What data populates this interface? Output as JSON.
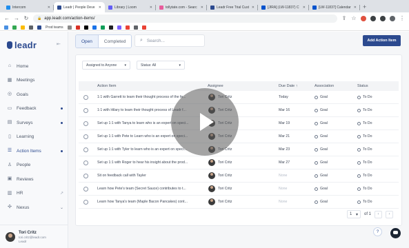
{
  "browser": {
    "tabs": [
      {
        "title": "Intercom",
        "color": "#1f8ded",
        "active": false
      },
      {
        "title": "Leadr | People Deve",
        "color": "#2c4a8f",
        "active": true
      },
      {
        "title": "Library | Loom",
        "color": "#625df5",
        "active": false
      },
      {
        "title": "tollytate.com - Searc",
        "color": "#e85d9c",
        "active": false
      },
      {
        "title": "Leadr Free Trial Cust",
        "color": "#2c4a8f",
        "active": false
      },
      {
        "title": "[JIRA] (LW-11837) C",
        "color": "#0052cc",
        "active": false
      },
      {
        "title": "[LW-11837] Calendar",
        "color": "#0052cc",
        "active": false
      }
    ],
    "new_tab": "+",
    "url": "app.leadr.com/action-items/",
    "bookmarks": {
      "label": "Prod teams"
    }
  },
  "sidebar": {
    "brand": "leadr",
    "nav": [
      {
        "label": "Home",
        "icon": "home-icon",
        "glyph": "⌂"
      },
      {
        "label": "Meetings",
        "icon": "calendar-icon",
        "glyph": "▦"
      },
      {
        "label": "Goals",
        "icon": "target-icon",
        "glyph": "◎"
      },
      {
        "label": "Feedback",
        "icon": "chat-icon",
        "glyph": "▭",
        "dot": true
      },
      {
        "label": "Surveys",
        "icon": "survey-icon",
        "glyph": "▤",
        "dot": true
      },
      {
        "label": "Learning",
        "icon": "book-icon",
        "glyph": "▯"
      },
      {
        "label": "Action Items",
        "icon": "checklist-icon",
        "glyph": "☰",
        "dot": true,
        "active": true
      },
      {
        "label": "People",
        "icon": "people-icon",
        "glyph": "♙"
      },
      {
        "label": "Reviews",
        "icon": "reviews-icon",
        "glyph": "▣"
      },
      {
        "label": "HR",
        "icon": "hr-icon",
        "glyph": "▥",
        "external": true
      },
      {
        "label": "Nexus",
        "icon": "nexus-icon",
        "glyph": "✣",
        "chevron": true
      }
    ],
    "user": {
      "name": "Tori Critz",
      "email": "tori.critz@leadr.com",
      "org": "Leadr"
    }
  },
  "main": {
    "tabs": [
      {
        "label": "Open",
        "active": true
      },
      {
        "label": "Completed",
        "active": false
      }
    ],
    "search_placeholder": "Search...",
    "add_button": "Add Action Item",
    "filters": {
      "assigned": "Assigned to Anyone",
      "status": "Status: All"
    },
    "columns": {
      "item": "Action Item",
      "assignee": "Assignee",
      "due": "Due Date",
      "association": "Association",
      "status": "Status"
    },
    "rows": [
      {
        "item": "1:1 with Garrett to learn their thought process of the fe...",
        "assignee": "Tori Critz",
        "due": "Today",
        "association": "Goal",
        "status": "To Do"
      },
      {
        "item": "1:1 with Hilary to learn their thought process of Leadr f...",
        "assignee": "Tori Critz",
        "due": "Mar 16",
        "association": "Goal",
        "status": "To Do"
      },
      {
        "item": "Set up 1:1 with Tanya to learn who is an expert on speci...",
        "assignee": "Tori Critz",
        "due": "Mar 19",
        "association": "Goal",
        "status": "To Do"
      },
      {
        "item": "Set up 1:1 with Pete to Learn who is an expert on speci...",
        "assignee": "Tori Critz",
        "due": "Mar 21",
        "association": "Goal",
        "status": "To Do"
      },
      {
        "item": "Set up 1:1 with Tyler to learn who is an expert on speci...",
        "assignee": "Tori Critz",
        "due": "Mar 23",
        "association": "Goal",
        "status": "To Do"
      },
      {
        "item": "Set up 1:1 with Roger to hear his insight about the prod...",
        "assignee": "Tori Critz",
        "due": "Mar 27",
        "association": "Goal",
        "status": "To Do"
      },
      {
        "item": "Sit on feedback call with Tayler",
        "assignee": "Tori Critz",
        "due": "None",
        "association": "Goal",
        "status": "To Do"
      },
      {
        "item": "Learn how Pete's team (Secret Sauce) contributes to t...",
        "assignee": "Tori Critz",
        "due": "None",
        "association": "Goal",
        "status": "To Do"
      },
      {
        "item": "Learn how Tanya's team (Maple Bacon Pancakes) cont...",
        "assignee": "Tori Critz",
        "due": "None",
        "association": "Goal",
        "status": "To Do"
      }
    ],
    "pagination": {
      "page": "1",
      "of": "of 1"
    }
  }
}
